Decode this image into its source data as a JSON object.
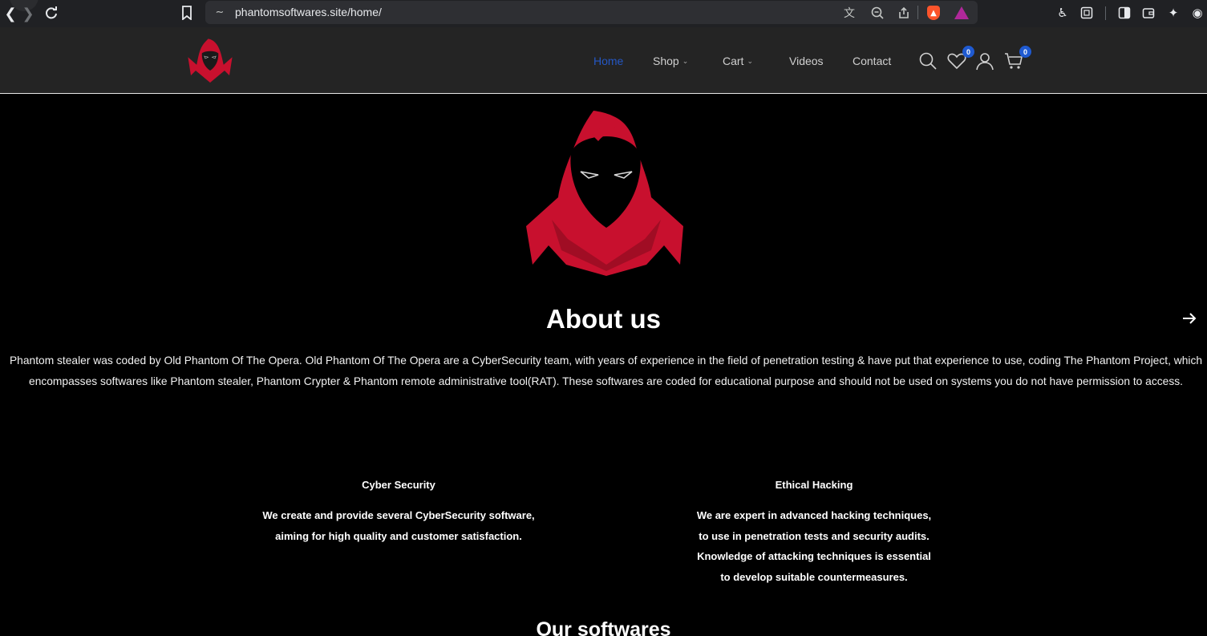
{
  "browser": {
    "url": "phantomsoftwares.site/home/",
    "icons": [
      "back-icon",
      "forward-icon",
      "reload-icon",
      "bookmark-icon",
      "site-settings-icon",
      "translate-icon",
      "zoom-icon",
      "share-icon",
      "brave-shields-icon",
      "brave-rewards-icon",
      "extensions-icon",
      "screenshot-icon",
      "sidebar-icon",
      "wallet-icon",
      "leo-icon",
      "vpn-icon"
    ]
  },
  "header": {
    "nav": [
      {
        "label": "Home",
        "active": true
      },
      {
        "label": "Shop",
        "dropdown": true
      },
      {
        "label": "Cart",
        "dropdown": true
      },
      {
        "label": "Videos"
      },
      {
        "label": "Contact"
      }
    ],
    "wishlist_count": "0",
    "cart_count": "0"
  },
  "about": {
    "title": "About us",
    "text": "Phantom stealer was coded by Old Phantom Of The Opera. Old Phantom Of The Opera are a CyberSecurity team, with years of experience in the field of penetration testing & have put that experience to use, coding  The Phantom Project, which encompasses softwares like Phantom stealer, Phantom Crypter & Phantom remote administrative tool(RAT). These softwares are coded for educational purpose and should not be used on systems you do not have permission to access."
  },
  "features": [
    {
      "title": "Cyber Security",
      "lines": [
        "We create and provide several CyberSecurity software,",
        "aiming for high quality and customer satisfaction."
      ]
    },
    {
      "title": "Ethical Hacking",
      "lines": [
        "We are expert in advanced hacking techniques,",
        "to use in penetration tests and security audits.",
        "Knowledge of attacking techniques is essential",
        "to develop suitable countermeasures."
      ]
    }
  ],
  "softwares_title": "Our softwares",
  "colors": {
    "accent": "#2457c5",
    "logo_red": "#c8102e",
    "header_bg": "#242424",
    "badge": "#1f5ad1"
  }
}
